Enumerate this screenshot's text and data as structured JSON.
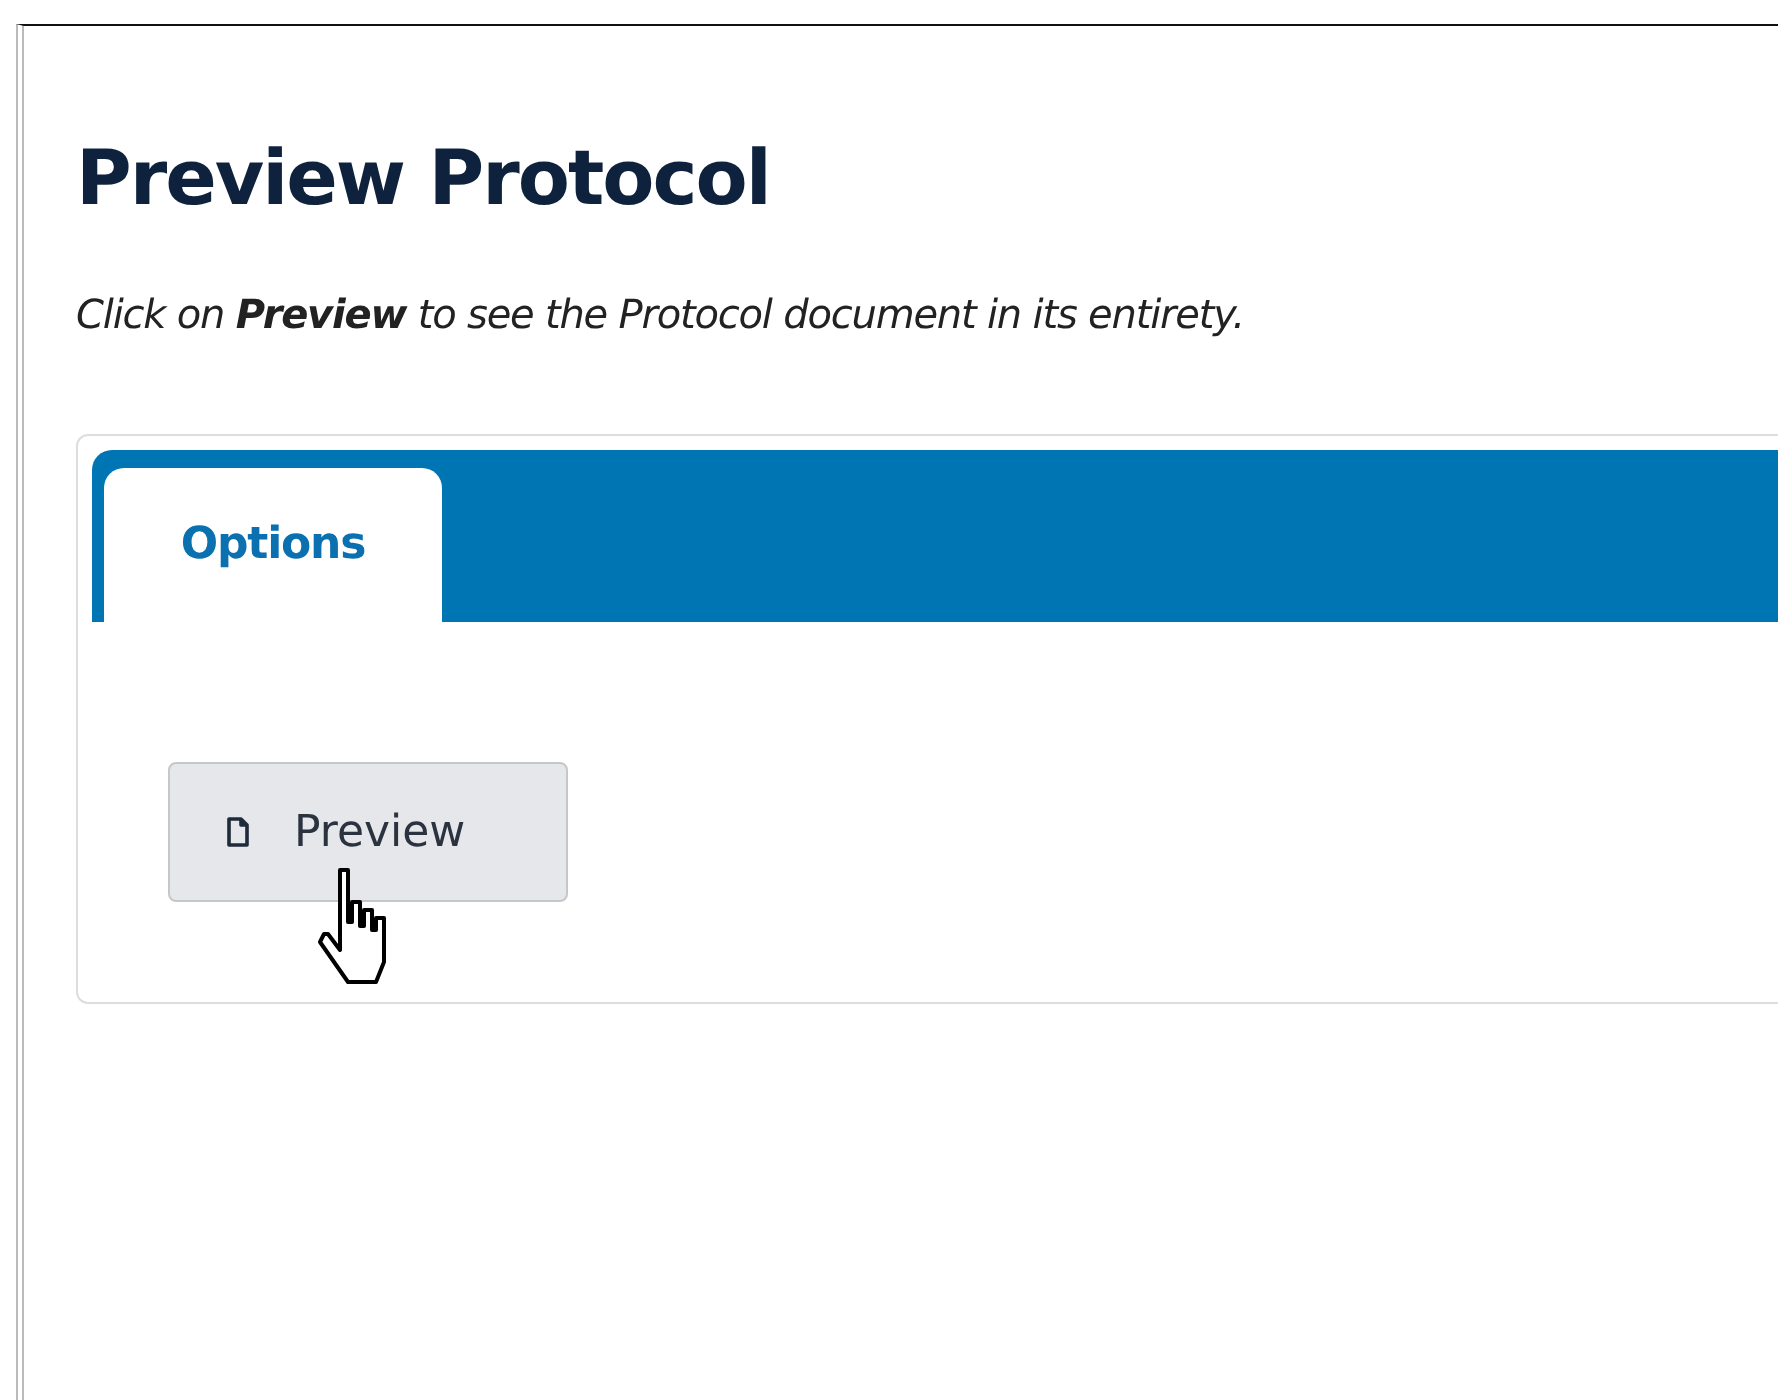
{
  "heading": "Preview Protocol",
  "instruction": "Click on **Preview** to see the Protocol document in its entirety.",
  "tabs": [
    {
      "label": "Options",
      "selected": true
    }
  ],
  "button": {
    "label": "Preview"
  }
}
